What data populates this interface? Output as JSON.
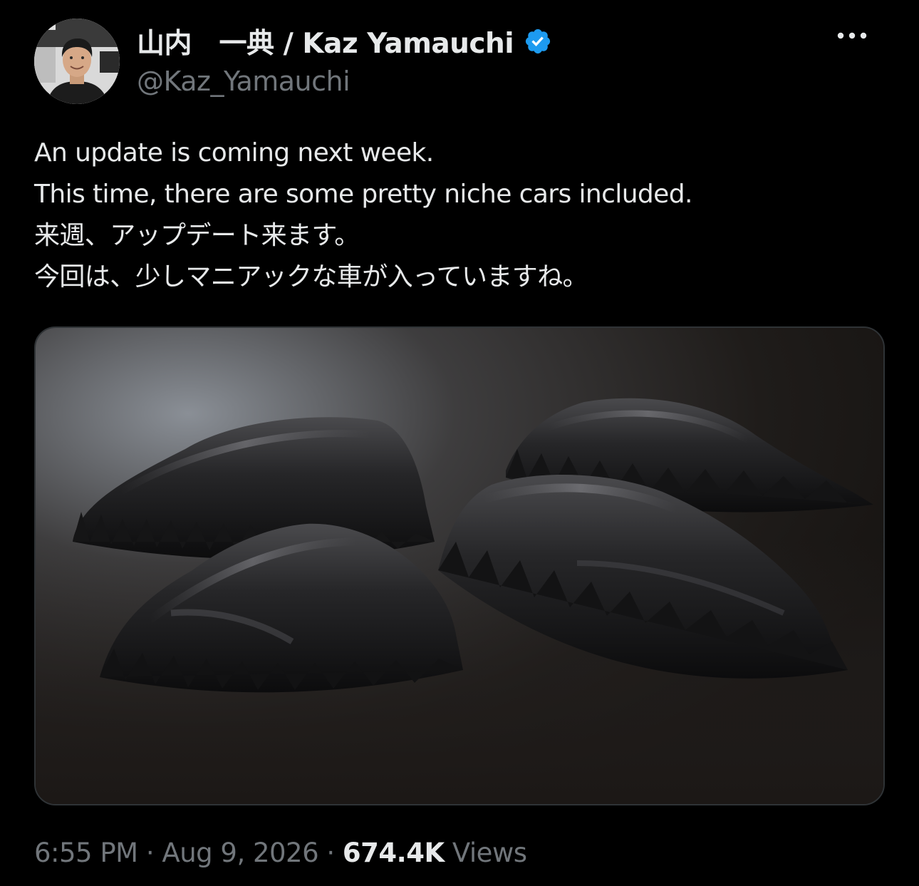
{
  "author": {
    "display_name": "山内　一典 / Kaz Yamauchi",
    "handle": "@Kaz_Yamauchi",
    "verified": true,
    "verified_color": "#1d9bf0"
  },
  "more_icon": "more-horizontal-icon",
  "tweet": {
    "lines": [
      "An update is coming next week.",
      "This time, there are some pretty niche cars included.",
      "来週、アップデート来ます。",
      "今回は、少しマニアックな車が入っていますね。"
    ]
  },
  "meta": {
    "time": "6:55 PM",
    "separator": " · ",
    "date": "Aug 9, 2026",
    "views_count": "674.4K",
    "views_label": " Views"
  },
  "colors": {
    "background": "#000000",
    "text_primary": "#e7e9ea",
    "text_secondary": "#71767b",
    "border": "#2f3336"
  }
}
